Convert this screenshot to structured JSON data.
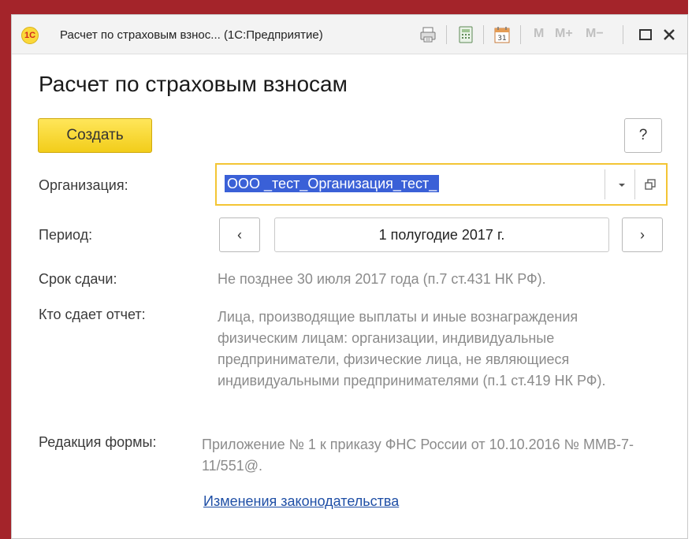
{
  "window": {
    "logo_text": "1С",
    "title": "Расчет по страховым взнос... (1С:Предприятие)",
    "toolbar": {
      "print_icon": "printer-icon",
      "calculator_icon": "calculator-icon",
      "calendar_icon": "calendar-icon",
      "calendar_day": "31",
      "m_label": "M",
      "m_plus_label": "M+",
      "m_minus_label": "M−",
      "maximize_icon": "maximize-icon",
      "close_icon": "close-icon"
    }
  },
  "form": {
    "title": "Расчет по страховым взносам",
    "create_label": "Создать",
    "help_label": "?",
    "organization": {
      "label": "Организация:",
      "value": "ООО _тест_Организация_тест_"
    },
    "period": {
      "label": "Период:",
      "prev": "‹",
      "value": "1 полугодие 2017 г.",
      "next": "›"
    },
    "deadline": {
      "label": "Срок сдачи:",
      "value": "Не позднее 30 июля 2017 года (п.7 ст.431 НК РФ)."
    },
    "who_submits": {
      "label": "Кто сдает отчет:",
      "value": "Лица, производящие выплаты и иные вознаграждения физическим лицам: организации, индивидуальные предприниматели, физические лица, не являющиеся индивидуальными предпринимателями (п.1 ст.419 НК РФ)."
    },
    "form_edition": {
      "label": "Редакция формы:",
      "value": "Приложение № 1 к приказу ФНС России от 10.10.2016 № ММВ-7-11/551@."
    },
    "legislation_link": "Изменения законодательства"
  },
  "colors": {
    "frame": "#a4242a",
    "create_button": "#f7d62a",
    "focus_border": "#f3c534",
    "selection": "#3a60d7",
    "link": "#1f4fa6"
  }
}
